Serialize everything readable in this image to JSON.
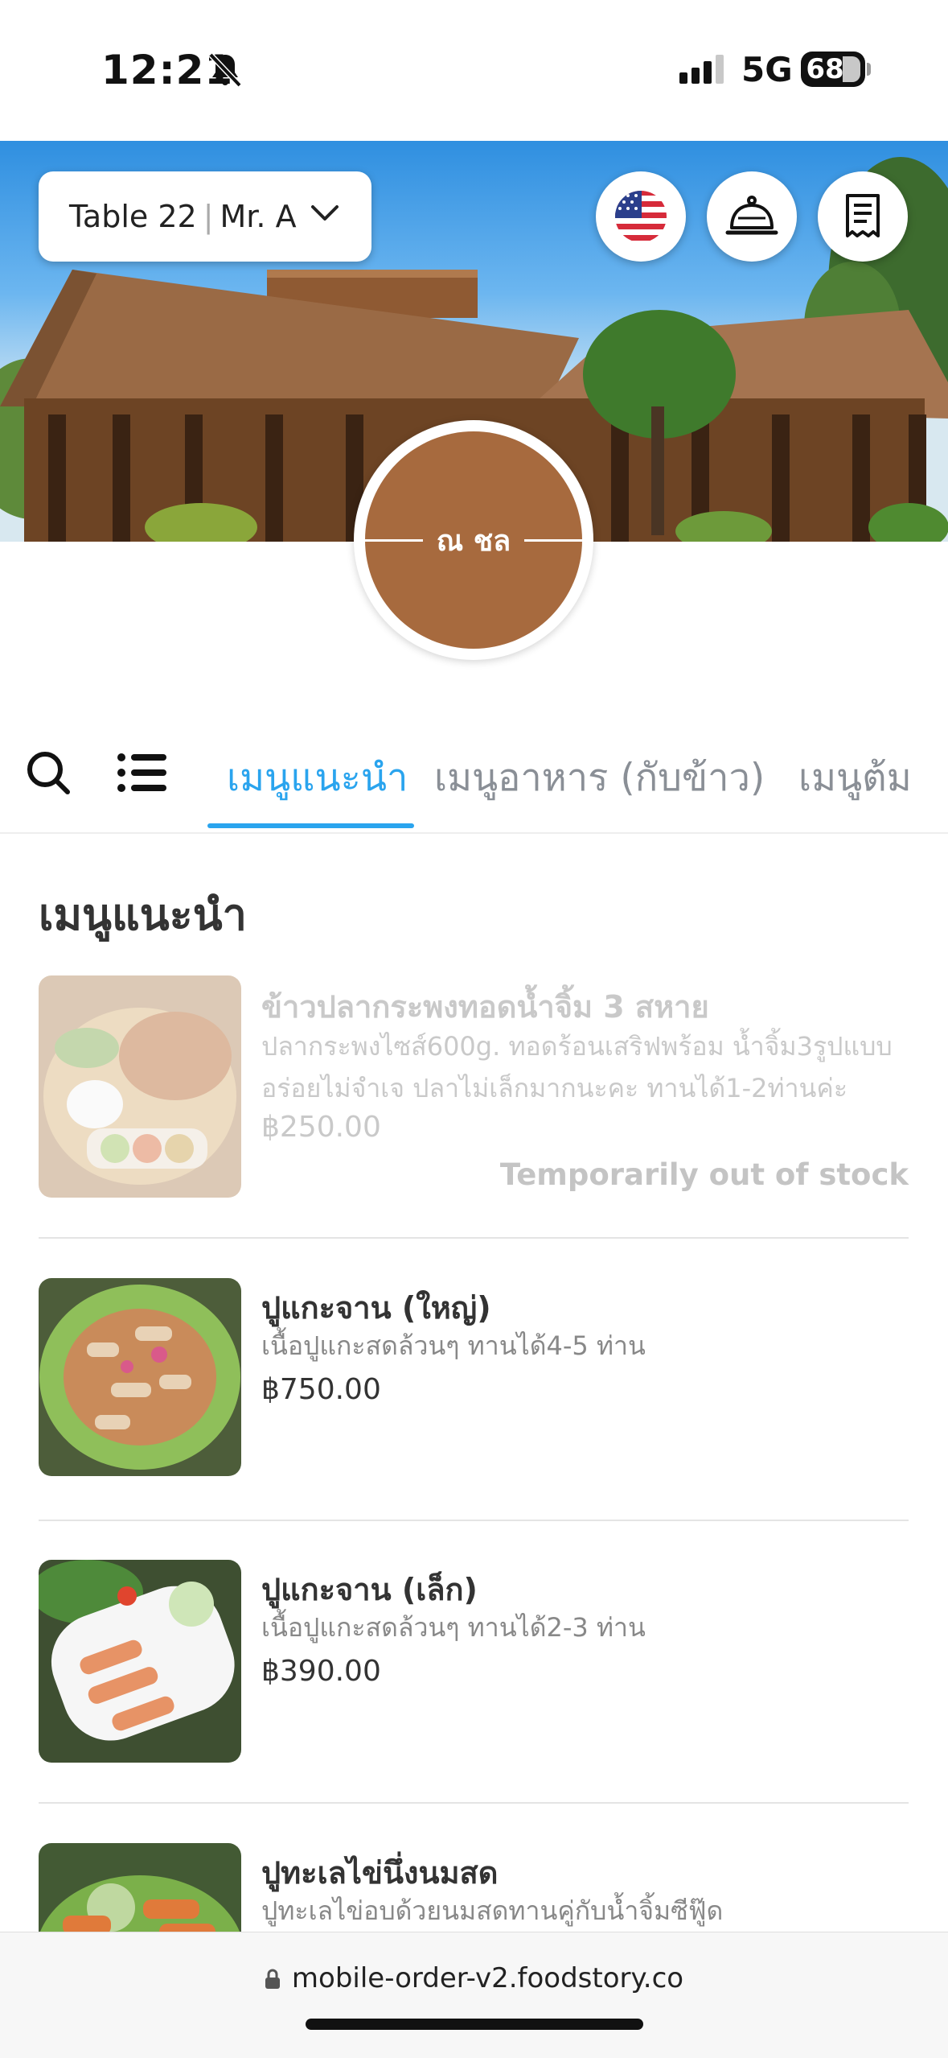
{
  "status_bar": {
    "time": "12:21",
    "network": "5G",
    "battery": "68"
  },
  "header": {
    "table_label": "Table 22",
    "separator": "|",
    "customer_name": "Mr. A",
    "restaurant_logo_text": "ณ ชล"
  },
  "icons": {
    "language": "us-flag-icon",
    "call_waiter": "service-bell-icon",
    "bill": "receipt-icon",
    "search": "search-icon",
    "categories": "list-icon"
  },
  "tabs": [
    {
      "label": "เมนูแนะนำ",
      "active": true
    },
    {
      "label": "เมนูอาหาร (กับข้าว)",
      "active": false
    },
    {
      "label": "เมนูต้ม",
      "active": false
    }
  ],
  "section": {
    "title": "เมนูแนะนำ"
  },
  "items": [
    {
      "name": "ข้าวปลากระพงทอดน้ำจิ้ม 3 สหาย",
      "description_line1": "ปลากระพงไซส์600g. ทอดร้อนเสริฟพร้อม น้ำจิ้ม3รูปแบบ",
      "description_line2": "อร่อยไม่จำเจ ปลาไม่เล็กมากนะคะ ทานได้1-2ท่านค่ะ",
      "price": "฿250.00",
      "stock_note": "Temporarily out of stock"
    },
    {
      "name": "ปูแกะจาน (ใหญ่)",
      "description_line1": "เนื้อปูแกะสดล้วนๆ ทานได้4-5 ท่าน",
      "price": "฿750.00"
    },
    {
      "name": "ปูแกะจาน (เล็ก)",
      "description_line1": "เนื้อปูแกะสดล้วนๆ ทานได้2-3 ท่าน",
      "price": "฿390.00"
    },
    {
      "name": "ปูทะเลไข่นึ่งนมสด",
      "description_line1": "ปูทะเลไข่อบด้วยนมสดทานคู่กับน้ำจิ้มซีฟู๊ด"
    }
  ],
  "browser": {
    "url": "mobile-order-v2.foodstory.co"
  },
  "colors": {
    "accent": "#2aa4ee",
    "logo_brown": "#a76a3e"
  }
}
